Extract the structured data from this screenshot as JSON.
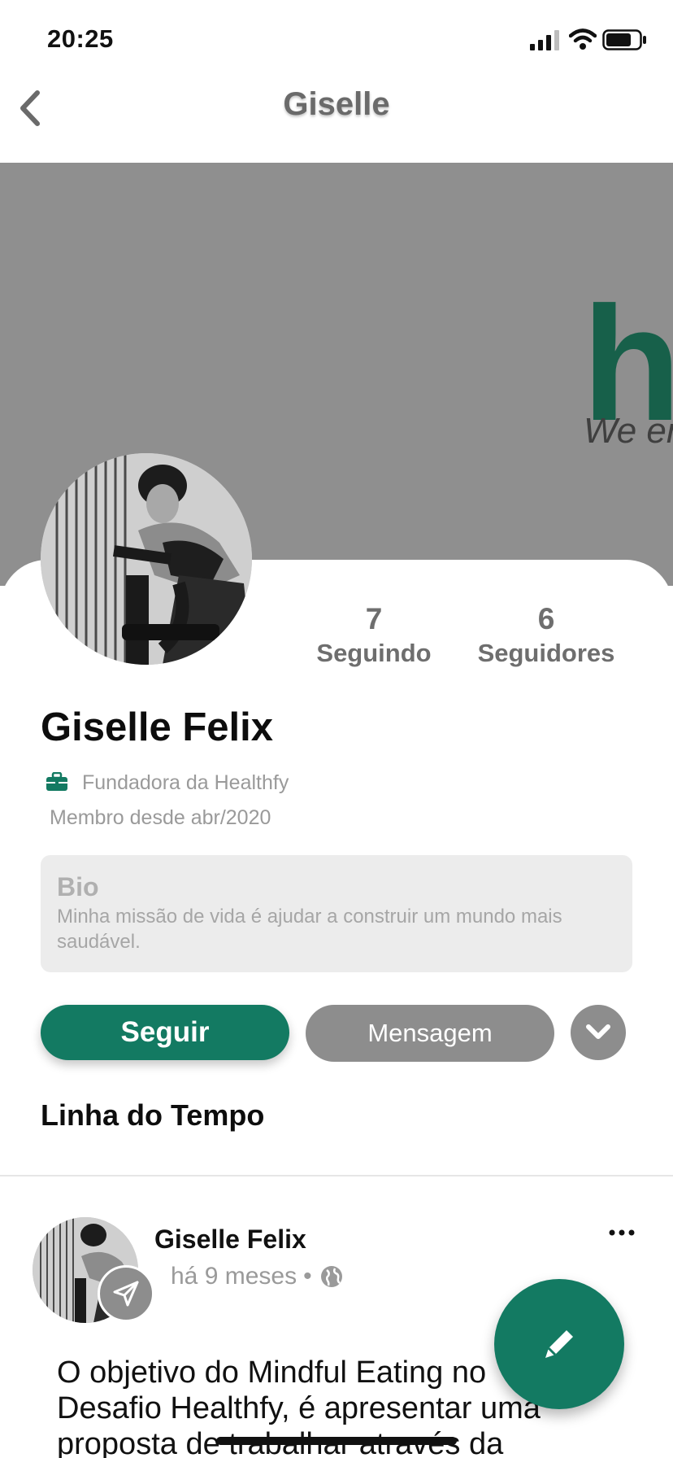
{
  "status_bar": {
    "time": "20:25"
  },
  "nav": {
    "title": "Giselle"
  },
  "cover": {
    "logo_text": "h",
    "tagline": "We en"
  },
  "profile": {
    "name": "Giselle Felix",
    "job": "Fundadora da Healthfy",
    "member_since": "Membro desde abr/2020",
    "stats": {
      "following_count": "7",
      "following_label": "Seguindo",
      "followers_count": "6",
      "followers_label": "Seguidores"
    },
    "bio": {
      "title": "Bio",
      "text": "Minha missão de vida é ajudar a construir um mundo mais saudável."
    }
  },
  "actions": {
    "follow_label": "Seguir",
    "message_label": "Mensagem"
  },
  "timeline": {
    "title": "Linha do Tempo",
    "post": {
      "author": "Giselle Felix",
      "time": "há 9 meses",
      "separator": "•",
      "body": "O objetivo do Mindful Eating no Desafio Healthfy, é apresentar uma proposta de trabalhar através da"
    }
  },
  "colors": {
    "primary": "#137a62",
    "secondary_button": "#8d8d8d",
    "cover": "#8f8f8f",
    "logo": "#17604a"
  },
  "icons": [
    "back-icon",
    "signal-icon",
    "wifi-icon",
    "battery-icon",
    "briefcase-icon",
    "chevron-down-icon",
    "paper-plane-icon",
    "globe-icon",
    "more-options-icon",
    "pencil-icon"
  ]
}
